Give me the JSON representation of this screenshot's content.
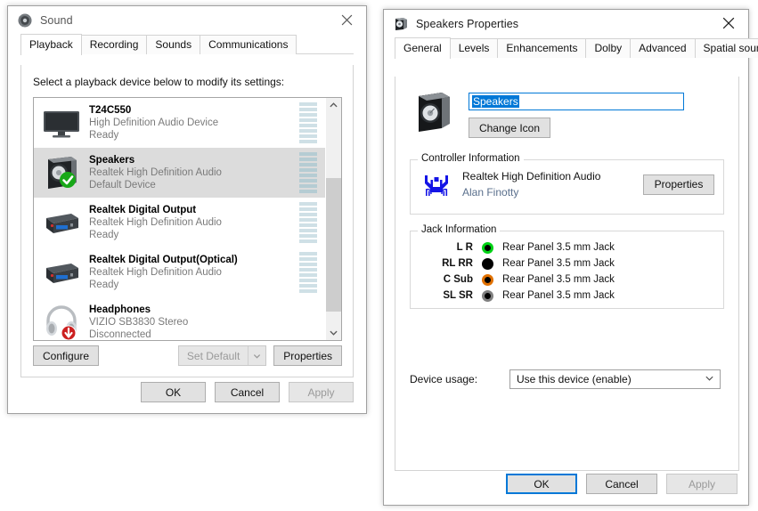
{
  "sound_window": {
    "title": "Sound",
    "icon": "speaker-icon",
    "close_label": "Close",
    "tabs": [
      {
        "label": "Playback",
        "active": true
      },
      {
        "label": "Recording",
        "active": false
      },
      {
        "label": "Sounds",
        "active": false
      },
      {
        "label": "Communications",
        "active": false
      }
    ],
    "hint": "Select a playback device below to modify its settings:",
    "devices": [
      {
        "name": "T24C550",
        "driver": "High Definition Audio Device",
        "status": "Ready",
        "icon": "monitor-icon",
        "selected": false,
        "badge": "none",
        "meter_segments": 8
      },
      {
        "name": "Speakers",
        "driver": "Realtek High Definition Audio",
        "status": "Default Device",
        "icon": "speaker-box-icon",
        "selected": true,
        "badge": "green-check",
        "meter_segments": 8
      },
      {
        "name": "Realtek Digital Output",
        "driver": "Realtek High Definition Audio",
        "status": "Ready",
        "icon": "digital-output-icon",
        "selected": false,
        "badge": "none",
        "meter_segments": 8
      },
      {
        "name": "Realtek Digital Output(Optical)",
        "driver": "Realtek High Definition Audio",
        "status": "Ready",
        "icon": "digital-output-icon",
        "selected": false,
        "badge": "none",
        "meter_segments": 8
      },
      {
        "name": "Headphones",
        "driver": "VIZIO SB3830 Stereo",
        "status": "Disconnected",
        "icon": "headphones-icon",
        "selected": false,
        "badge": "red-down-arrow",
        "meter_segments": 0
      }
    ],
    "buttons": {
      "configure": "Configure",
      "set_default": "Set Default",
      "properties": "Properties",
      "ok": "OK",
      "cancel": "Cancel",
      "apply": "Apply"
    }
  },
  "props_window": {
    "title": "Speakers Properties",
    "icon": "speaker-icon",
    "close_label": "Close",
    "tabs": [
      {
        "label": "General",
        "active": true
      },
      {
        "label": "Levels",
        "active": false
      },
      {
        "label": "Enhancements",
        "active": false
      },
      {
        "label": "Dolby",
        "active": false
      },
      {
        "label": "Advanced",
        "active": false
      },
      {
        "label": "Spatial sound",
        "active": false
      }
    ],
    "device_name_value": "Speakers",
    "change_icon_label": "Change Icon",
    "controller": {
      "group_title": "Controller Information",
      "name": "Realtek High Definition Audio",
      "author": "Alan Finotty",
      "properties_label": "Properties",
      "logo": "realtek-logo-icon"
    },
    "jack_info": {
      "group_title": "Jack Information",
      "jacks": [
        {
          "label": "L R",
          "color": "#00d215",
          "description": "Rear Panel 3.5 mm Jack"
        },
        {
          "label": "RL RR",
          "color": "#000000",
          "description": "Rear Panel 3.5 mm Jack"
        },
        {
          "label": "C Sub",
          "color": "#e07000",
          "description": "Rear Panel 3.5 mm Jack"
        },
        {
          "label": "SL SR",
          "color": "#808080",
          "description": "Rear Panel 3.5 mm Jack"
        }
      ]
    },
    "device_usage": {
      "label": "Device usage:",
      "value": "Use this device (enable)"
    },
    "buttons": {
      "ok": "OK",
      "cancel": "Cancel",
      "apply": "Apply"
    }
  },
  "colors": {
    "accent": "#0078d7",
    "selection": "#dcdcdc",
    "meter": "#cfe0e6"
  }
}
